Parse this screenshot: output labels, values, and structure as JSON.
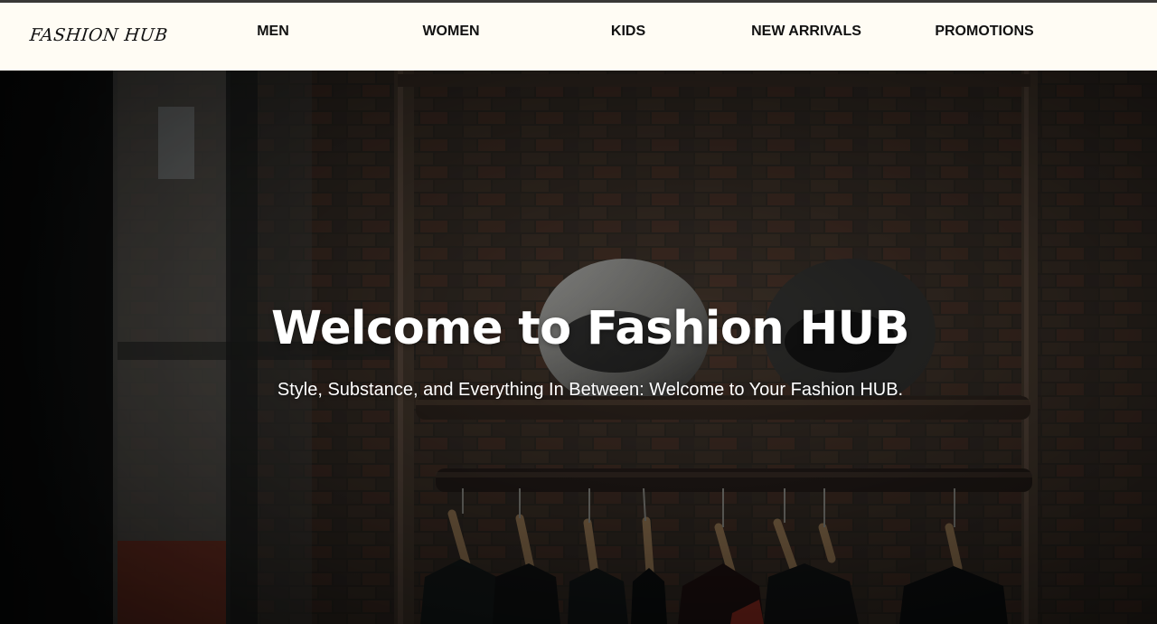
{
  "brand": {
    "logo_text": "FASHION HUB"
  },
  "nav": {
    "items": [
      {
        "label": "MEN"
      },
      {
        "label": "WOMEN"
      },
      {
        "label": "KIDS"
      },
      {
        "label": "NEW ARRIVALS"
      },
      {
        "label": "PROMOTIONS"
      }
    ]
  },
  "hero": {
    "title": "Welcome to Fashion HUB",
    "subtitle": "Style, Substance, and Everything In Between: Welcome to Your Fashion HUB."
  },
  "colors": {
    "navbar_bg": "#fffcf4",
    "nav_text": "#111111",
    "hero_text": "#ffffff"
  }
}
